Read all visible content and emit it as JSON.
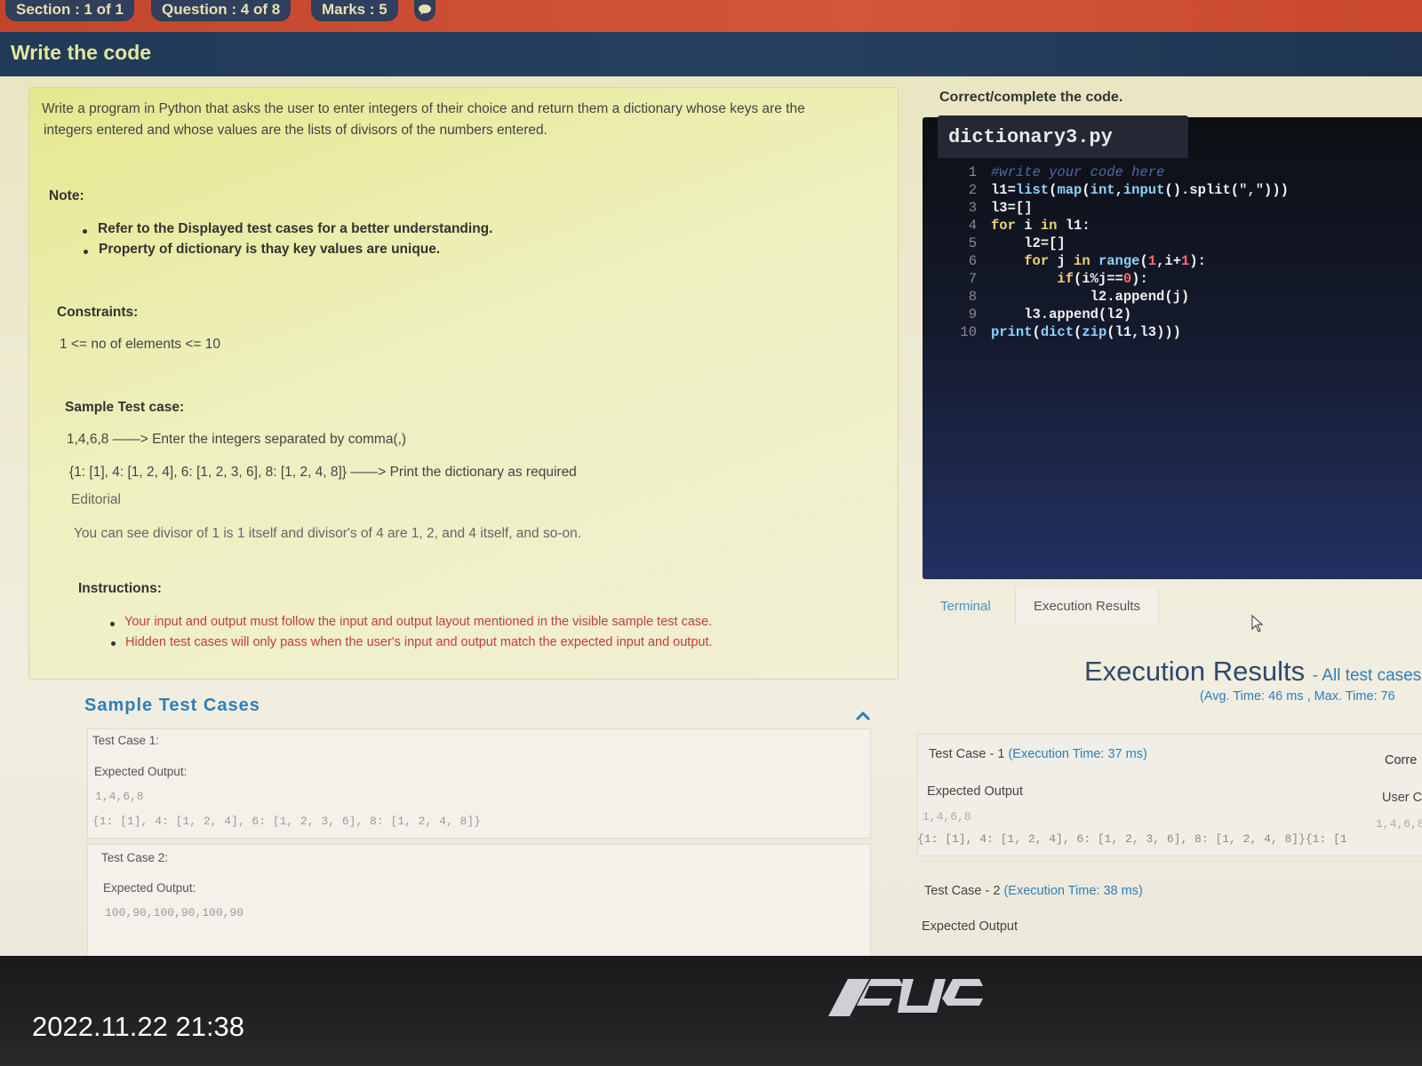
{
  "header": {
    "section": "Section : 1 of 1",
    "question": "Question : 4 of 8",
    "marks": "Marks : 5",
    "chat_icon": "chat-icon",
    "title": "Write the code"
  },
  "problem": {
    "line1": "Write a program in Python that asks the user to enter integers of their choice and return them a dictionary whose keys are the",
    "line2": "integers entered and whose values are the lists of divisors of the numbers entered.",
    "note_label": "Note:",
    "notes": [
      "Refer to the Displayed test cases for a better understanding.",
      "Property of dictionary is thay key values are unique."
    ],
    "constraints_label": "Constraints:",
    "constraint": "1 <= no of elements <= 10",
    "sample_label": "Sample Test case:",
    "sample_input": "1,4,6,8 ——> Enter the integers separated by comma(,)",
    "sample_output": "{1: [1], 4: [1, 2, 4], 6: [1, 2, 3, 6], 8: [1, 2, 4, 8]} ——> Print the dictionary as required",
    "editorial_label": "Editorial",
    "editorial": "You can see divisor of 1 is 1 itself and divisor's of 4 are 1, 2, and 4 itself, and so-on.",
    "instructions_label": "Instructions:",
    "instructions": [
      "Your input and output must follow the input and output layout mentioned in the visible sample test case.",
      "Hidden test cases will only pass when the user's input and output match the expected input and output."
    ]
  },
  "sample_cases": {
    "title": "Sample Test Cases",
    "case1": {
      "label": "Test Case 1:",
      "expected_label": "Expected Output:",
      "input": "1,4,6,8",
      "output": "{1: [1], 4: [1, 2, 4], 6: [1, 2, 3, 6], 8: [1, 2, 4, 8]}"
    },
    "case2": {
      "label": "Test Case 2:",
      "expected_label": "Expected Output:",
      "input": "100,90,100,90,100,90"
    }
  },
  "editor": {
    "label": "Correct/complete the code.",
    "filename": "dictionary3.py"
  },
  "tabs": {
    "terminal": "Terminal",
    "execution": "Execution Results"
  },
  "results": {
    "title": "Execution Results",
    "subtitle": "- All test cases",
    "times": "(Avg. Time: 46 ms , Max. Time: 76",
    "case1": {
      "label": "Test Case - 1",
      "time": "(Execution Time: 37 ms)",
      "status": "Corre",
      "expected_label": "Expected Output",
      "user_label": "User C",
      "input": "1,4,6,8",
      "user_input": "1,4,6,8",
      "output": "{1: [1], 4: [1, 2, 4], 6: [1, 2, 3, 6], 8: [1, 2, 4, 8]}{1: [1"
    },
    "case2": {
      "label": "Test Case - 2",
      "time": "(Execution Time: 38 ms)",
      "expected_label": "Expected Output"
    }
  },
  "bezel": {
    "brand": "ASUS",
    "timestamp": "2022.11.22 21:38"
  }
}
